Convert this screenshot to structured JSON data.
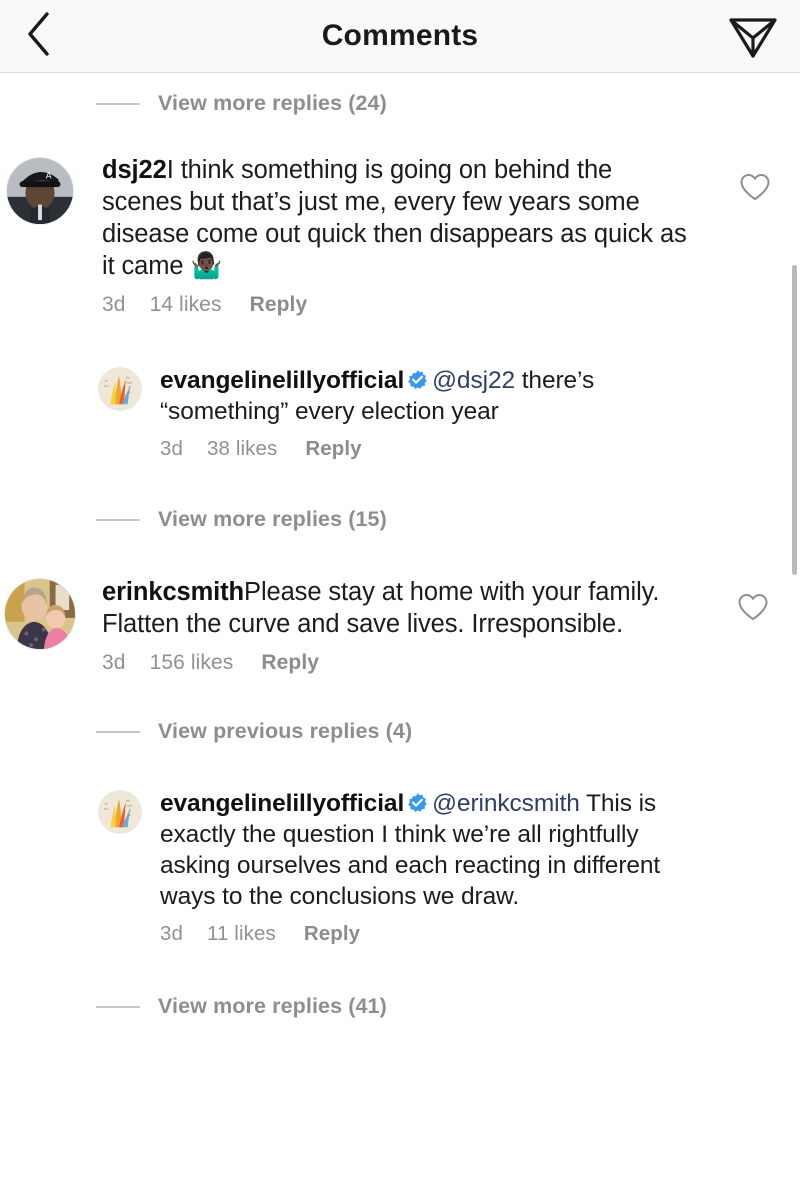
{
  "header": {
    "title": "Comments",
    "back_icon": "chevron-left-icon",
    "share_icon": "paper-plane-icon"
  },
  "feed": {
    "items": [
      {
        "kind": "view_replies",
        "label": "View more replies (24)"
      },
      {
        "kind": "comment",
        "username": "dsj22",
        "verified": false,
        "mention": "",
        "text": "I think something is going on behind the scenes but that’s just me, every few years some disease come out quick then disappears as quick as it came 🤷🏿‍♂️",
        "time": "3d",
        "likes": "14 likes",
        "reply": "Reply",
        "avatar": "dsj22-avatar",
        "like_icon": "heart-outline-icon"
      },
      {
        "kind": "reply",
        "username": "evangelinelillyofficial",
        "verified": true,
        "mention": "@dsj22",
        "text": " there’s “something” every election year",
        "time": "3d",
        "likes": "38 likes",
        "reply": "Reply",
        "avatar": "evangelinelillyofficial-avatar",
        "like_icon": "heart-outline-icon"
      },
      {
        "kind": "view_replies",
        "label": "View more replies (15)"
      },
      {
        "kind": "comment",
        "username": "erinkcsmith",
        "verified": false,
        "mention": "",
        "text": "Please stay at home with your family. Flatten the curve and save lives. Irresponsible.",
        "time": "3d",
        "likes": "156 likes",
        "reply": "Reply",
        "avatar": "erinkcsmith-avatar",
        "like_icon": "heart-outline-icon"
      },
      {
        "kind": "view_replies",
        "label": "View previous replies (4)"
      },
      {
        "kind": "reply",
        "username": "evangelinelillyofficial",
        "verified": true,
        "mention": "@erinkcsmith",
        "text": " This is exactly the question I think we’re all rightfully asking ourselves and each reacting in different ways to the conclusions we draw.",
        "time": "3d",
        "likes": "11 likes",
        "reply": "Reply",
        "avatar": "evangelinelillyofficial-avatar",
        "like_icon": "heart-outline-icon"
      },
      {
        "kind": "view_replies",
        "label": "View more replies (41)"
      }
    ]
  },
  "colors": {
    "text": "#1c1c1c",
    "muted": "#919191",
    "mention": "#2f3e67",
    "verified_blue": "#3897f0",
    "header_bg": "#f9f9f9",
    "background": "#ffffff"
  }
}
